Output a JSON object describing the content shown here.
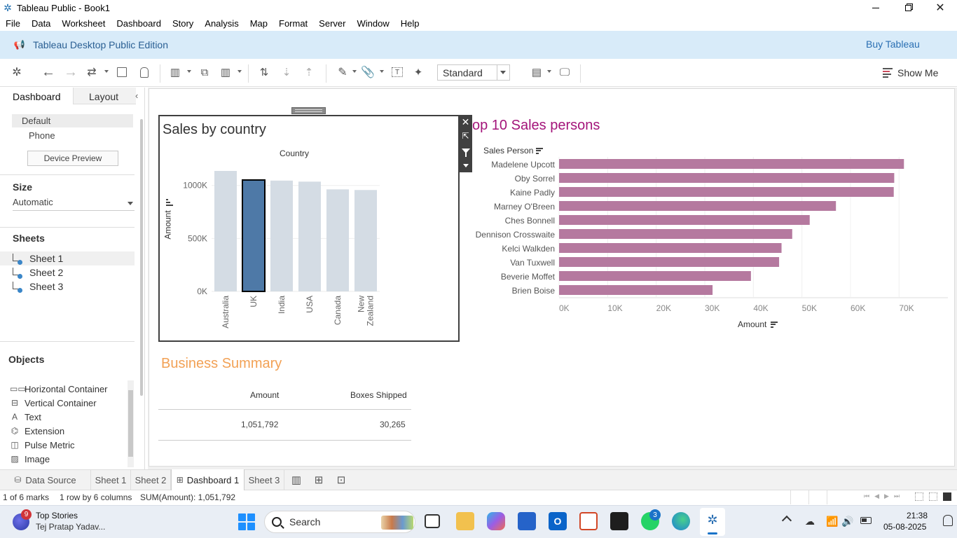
{
  "window": {
    "title": "Tableau Public - Book1"
  },
  "menu": [
    "File",
    "Data",
    "Worksheet",
    "Dashboard",
    "Story",
    "Analysis",
    "Map",
    "Format",
    "Server",
    "Window",
    "Help"
  ],
  "banner": {
    "edition": "Tableau Desktop Public Edition",
    "buy": "Buy Tableau"
  },
  "toolbar": {
    "fit_select": "Standard",
    "show_me": "Show Me"
  },
  "sidebar": {
    "tabs": [
      "Dashboard",
      "Layout"
    ],
    "devices": [
      "Default",
      "Phone"
    ],
    "device_preview": "Device Preview",
    "size_label": "Size",
    "size_value": "Automatic",
    "sheets_label": "Sheets",
    "sheets": [
      "Sheet 1",
      "Sheet 2",
      "Sheet 3"
    ],
    "objects_label": "Objects",
    "objects": [
      {
        "label": "Horizontal Container",
        "icon": "horizontal-container-icon"
      },
      {
        "label": "Vertical Container",
        "icon": "vertical-container-icon"
      },
      {
        "label": "Text",
        "icon": "text-icon"
      },
      {
        "label": "Extension",
        "icon": "extension-icon"
      },
      {
        "label": "Pulse Metric",
        "icon": "pulse-metric-icon"
      },
      {
        "label": "Image",
        "icon": "image-icon"
      }
    ]
  },
  "dashboard": {
    "country_chart_title": "Sales by country",
    "sales_title": "op 10 Sales persons",
    "summary_title": "Business Summary",
    "summary": {
      "headers": [
        "Amount",
        "Boxes Shipped"
      ],
      "values": [
        "1,051,792",
        "30,265"
      ]
    }
  },
  "chart_data": [
    {
      "type": "bar",
      "title": "Sales by country",
      "xlabel": "Country",
      "ylabel": "Amount",
      "categories": [
        "Australia",
        "UK",
        "India",
        "USA",
        "Canada",
        "New Zealand"
      ],
      "values": [
        1137000,
        1051792,
        1046000,
        1036000,
        963000,
        957000
      ],
      "selected": "UK",
      "yticks": [
        "0K",
        "500K",
        "1000K"
      ],
      "ylim": [
        0,
        1190000
      ],
      "colors": {
        "bar": "#d4dce4",
        "selected": "#4e79a7"
      }
    },
    {
      "type": "bar",
      "orientation": "horizontal",
      "title": "op 10 Sales persons",
      "ylabel": "Sales Person",
      "xlabel": "Amount",
      "categories": [
        "Madelene Upcott",
        "Oby Sorrel",
        "Kaine Padly",
        "Marney O'Breen",
        "Ches Bonnell",
        "Dennison Crosswaite",
        "Kelci Walkden",
        "Van Tuxwell",
        "Beverie Moffet",
        "Brien Boise"
      ],
      "values": [
        71000,
        69000,
        68900,
        57000,
        51600,
        48000,
        45800,
        45300,
        39500,
        31600
      ],
      "xticks": [
        "0K",
        "10K",
        "20K",
        "30K",
        "40K",
        "50K",
        "60K",
        "70K"
      ],
      "xlim": [
        0,
        75000
      ],
      "colors": {
        "bar": "#b5799f"
      }
    }
  ],
  "tabs": [
    "Data Source",
    "Sheet 1",
    "Sheet 2",
    "Dashboard 1",
    "Sheet 3"
  ],
  "status": {
    "marks": "1 of 6 marks",
    "rows": "1 row by 6 columns",
    "sum": "SUM(Amount): 1,051,792"
  },
  "taskbar": {
    "news_title": "Top Stories",
    "news_sub": "Tej Pratap Yadav...",
    "news_badge": "9",
    "search_placeholder": "Search",
    "whatsapp_badge": "3",
    "time": "21:38",
    "date": "05-08-2025"
  }
}
